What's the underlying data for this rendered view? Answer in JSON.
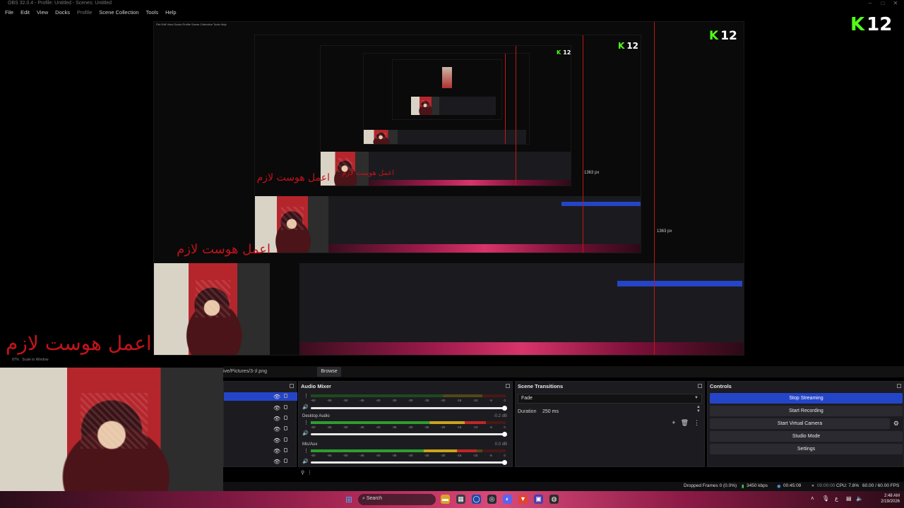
{
  "window": {
    "title": "OBS 32.0.4 - Profile: Untitled - Scenes: Untitled",
    "menu": [
      "File",
      "Edit",
      "View",
      "Docks",
      "Profile",
      "Scene Collection",
      "Tools",
      "Help"
    ]
  },
  "preview": {
    "kick_badge_number": "12",
    "canvas_width_label": "1363 px",
    "arabic_caption": "اعمل هوست لازم",
    "zoom_label": "87%",
    "scale_label": "Scale to Window"
  },
  "source_path": {
    "path": "ive/Pictures/3-لا.png",
    "browse_label": "Browse"
  },
  "audio_mixer": {
    "title": "Audio Mixer",
    "ticks": [
      "-60",
      "-55",
      "-50",
      "-45",
      "-40",
      "-35",
      "-30",
      "-25",
      "-20",
      "-15",
      "-10",
      "-5",
      "0"
    ],
    "tracks": [
      {
        "name": "",
        "db": "",
        "level": 0.0
      },
      {
        "name": "Desktop Audio",
        "db": "-0.2 dB",
        "level": 0.9
      },
      {
        "name": "Mic/Aux",
        "db": "0.0 dB",
        "level": 0.85
      }
    ]
  },
  "scene_transitions": {
    "title": "Scene Transitions",
    "transition": "Fade",
    "duration_label": "Duration",
    "duration_value": "250 ms"
  },
  "controls": {
    "title": "Controls",
    "buttons": [
      "Stop Streaming",
      "Start Recording",
      "Start Virtual Camera",
      "Studio Mode",
      "Settings"
    ]
  },
  "status": {
    "dropped_frames": "Dropped Frames 0 (0.0%)",
    "bitrate": "3450 kbps",
    "stream_time": "00:45:09",
    "rec_time": "00:00:00",
    "cpu": "CPU: 7.8%",
    "fps": "60.00 / 60.00 FPS"
  },
  "taskbar": {
    "search_placeholder": "Search",
    "time": "2:48 AM",
    "date": "2/19/2026"
  },
  "colors": {
    "accent_blue": "#2545c8",
    "kick_green": "#53fc18",
    "caption_red": "#c4131b"
  }
}
